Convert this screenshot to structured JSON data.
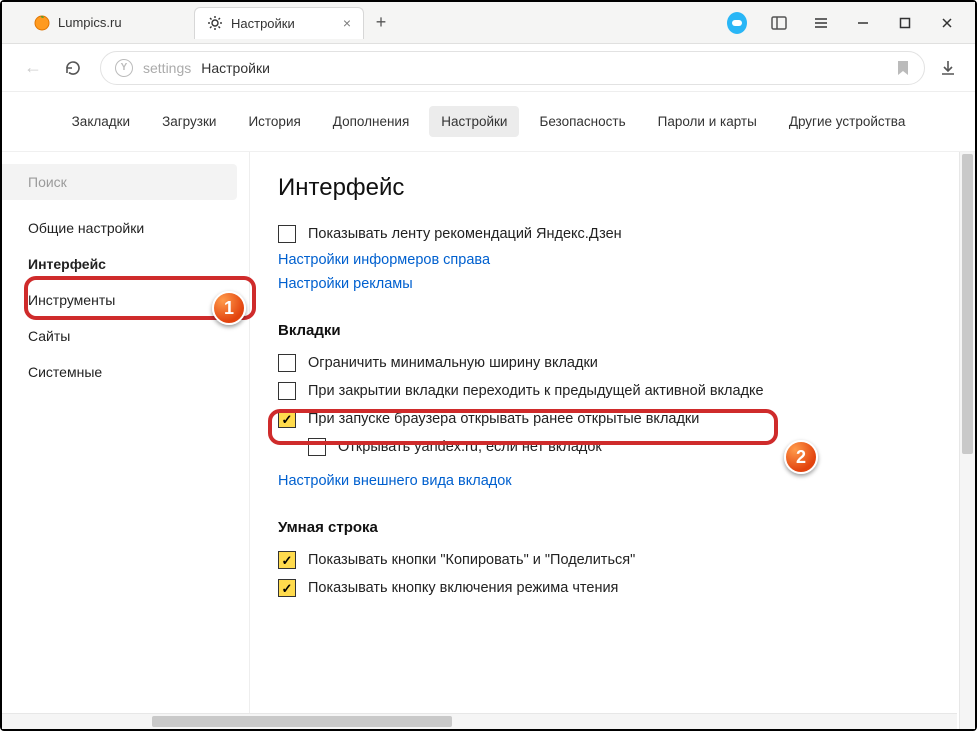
{
  "tabs": [
    {
      "title": "Lumpics.ru",
      "favicon": "orange"
    },
    {
      "title": "Настройки",
      "favicon": "gear"
    }
  ],
  "address": {
    "prefix": "settings",
    "label": "Настройки"
  },
  "settingsNav": [
    "Закладки",
    "Загрузки",
    "История",
    "Дополнения",
    "Настройки",
    "Безопасность",
    "Пароли и карты",
    "Другие устройства"
  ],
  "sidebar": {
    "searchPlaceholder": "Поиск",
    "items": [
      "Общие настройки",
      "Интерфейс",
      "Инструменты",
      "Сайты",
      "Системные"
    ],
    "activeIndex": 1
  },
  "content": {
    "heading": "Интерфейс",
    "zenCheckbox": "Показывать ленту рекомендаций Яндекс.Дзен",
    "link1": "Настройки информеров справа",
    "link2": "Настройки рекламы",
    "tabsHeading": "Вкладки",
    "tabOpt1": "Ограничить минимальную ширину вкладки",
    "tabOpt2": "При закрытии вкладки переходить к предыдущей активной вкладке",
    "tabOpt3": "При запуске браузера открывать ранее открытые вкладки",
    "tabOpt4": "Открывать yandex.ru, если нет вкладок",
    "link3": "Настройки внешнего вида вкладок",
    "smartHeading": "Умная строка",
    "smartOpt1": "Показывать кнопки \"Копировать\" и \"Поделиться\"",
    "smartOpt2": "Показывать кнопку включения режима чтения"
  },
  "badges": {
    "one": "1",
    "two": "2"
  }
}
